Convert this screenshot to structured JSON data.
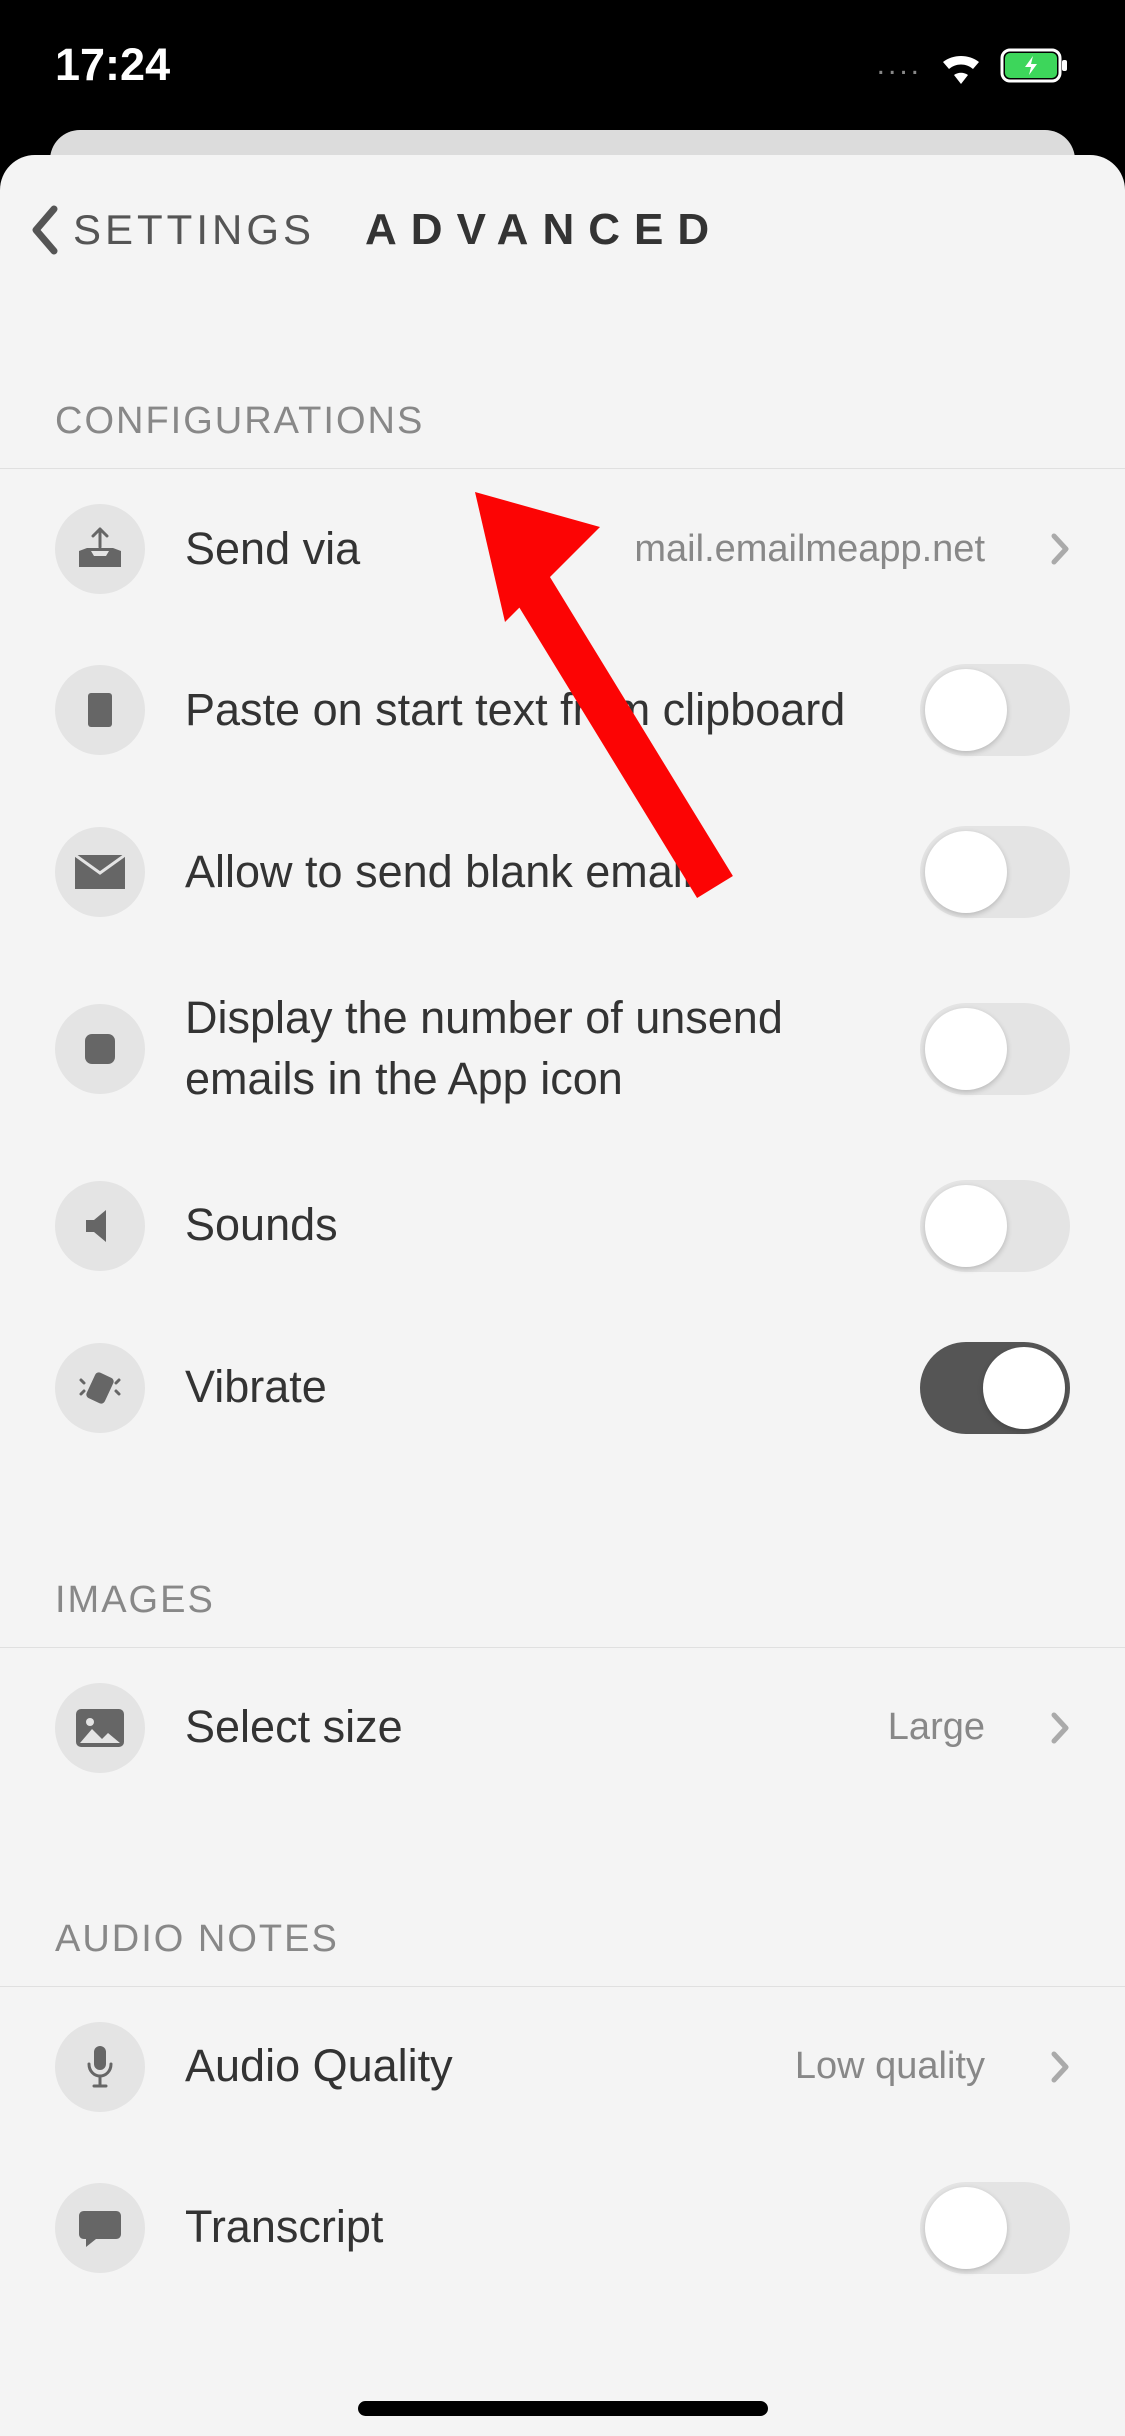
{
  "status": {
    "time": "17:24"
  },
  "nav": {
    "back_label": "SETTINGS",
    "title": "ADVANCED"
  },
  "sections": {
    "configurations": {
      "header": "CONFIGURATIONS",
      "send_via": {
        "label": "Send via",
        "value": "mail.emailmeapp.net"
      },
      "paste": {
        "label": "Paste on start text from clipboard"
      },
      "blank_emails": {
        "label": "Allow to send blank emails"
      },
      "display_unsend": {
        "label": "Display the number of unsend emails in the App icon"
      },
      "sounds": {
        "label": "Sounds"
      },
      "vibrate": {
        "label": "Vibrate"
      }
    },
    "images": {
      "header": "IMAGES",
      "select_size": {
        "label": "Select size",
        "value": "Large"
      }
    },
    "audio_notes": {
      "header": "AUDIO NOTES",
      "audio_quality": {
        "label": "Audio Quality",
        "value": "Low quality"
      },
      "transcript": {
        "label": "Transcript"
      }
    }
  }
}
